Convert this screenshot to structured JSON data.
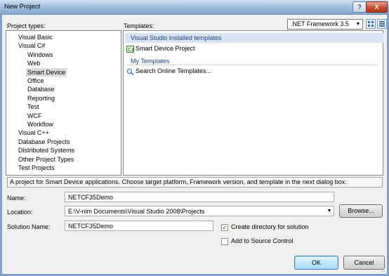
{
  "window": {
    "title": "New Project",
    "help_button": "?",
    "close_button": "X"
  },
  "project_types": {
    "label": "Project types:",
    "items": [
      {
        "label": "Visual Basic"
      },
      {
        "label": "Visual C#"
      },
      {
        "label": "Windows"
      },
      {
        "label": "Web"
      },
      {
        "label": "Smart Device"
      },
      {
        "label": "Office"
      },
      {
        "label": "Database"
      },
      {
        "label": "Reporting"
      },
      {
        "label": "Test"
      },
      {
        "label": "WCF"
      },
      {
        "label": "Workflow"
      },
      {
        "label": "Visual C++"
      },
      {
        "label": "Database Projects"
      },
      {
        "label": "Distributed Systems"
      },
      {
        "label": "Other Project Types"
      },
      {
        "label": "Test Projects"
      }
    ],
    "selected": "Smart Device"
  },
  "templates": {
    "label": "Templates:",
    "framework": ".NET Framework 3.5",
    "installed_header": "Visual Studio installed templates",
    "installed_items": [
      {
        "label": "Smart Device Project",
        "icon": "smart-device-project-icon"
      }
    ],
    "my_header": "My Templates",
    "my_items": [
      {
        "label": "Search Online Templates...",
        "icon": "search-online-icon"
      }
    ]
  },
  "description": "A project for Smart Device applications. Choose target platform, Framework version, and template in the next dialog box.",
  "form": {
    "name_label": "Name:",
    "name_value": "NETCF35Demo",
    "location_label": "Location:",
    "location_value": "E:\\V-nim Documents\\Visual Studio 2008\\Projects",
    "browse_label": "Browse...",
    "solution_label": "Solution Name:",
    "solution_value": "NETCF35Demo",
    "create_dir_label": "Create directory for solution",
    "create_dir_checked": true,
    "source_control_label": "Add to Source Control",
    "source_control_checked": false
  },
  "buttons": {
    "ok": "OK",
    "cancel": "Cancel"
  }
}
